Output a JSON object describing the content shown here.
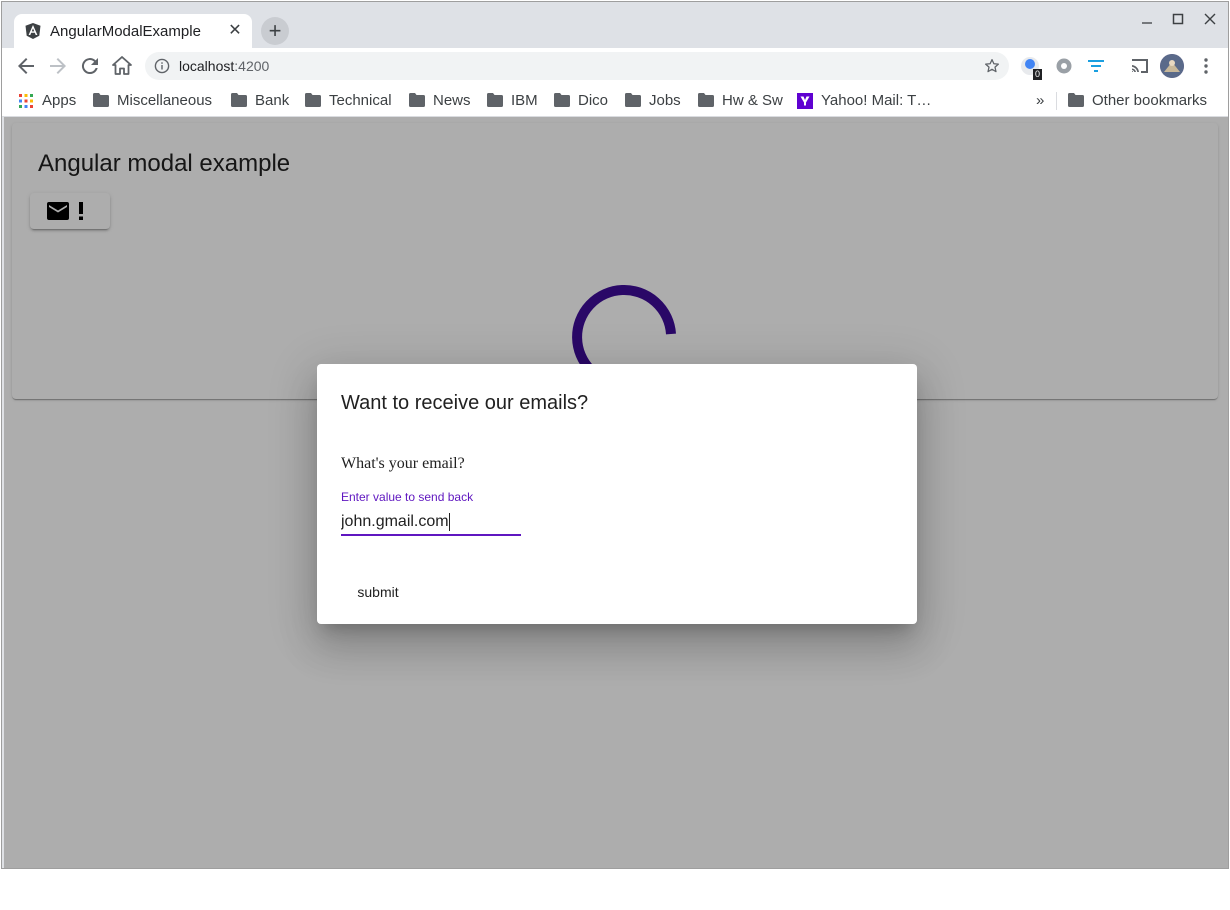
{
  "browser": {
    "tab_title": "AngularModalExample",
    "url_host": "localhost",
    "url_port": ":4200",
    "extension_badge": "0",
    "bookmarks": [
      {
        "label": "Apps",
        "icon": "apps-grid-icon"
      },
      {
        "label": "Miscellaneous",
        "icon": "folder-icon"
      },
      {
        "label": "Bank",
        "icon": "folder-icon"
      },
      {
        "label": "Technical",
        "icon": "folder-icon"
      },
      {
        "label": "News",
        "icon": "folder-icon"
      },
      {
        "label": "IBM",
        "icon": "folder-icon"
      },
      {
        "label": "Dico",
        "icon": "folder-icon"
      },
      {
        "label": "Jobs",
        "icon": "folder-icon"
      },
      {
        "label": "Hw & Sw",
        "icon": "folder-icon"
      },
      {
        "label": "Yahoo! Mail: T…",
        "icon": "yahoo-icon"
      }
    ],
    "overflow": "»",
    "other_bookmarks": "Other bookmarks"
  },
  "page": {
    "title": "Angular modal example",
    "toolbar_icons": [
      "mail-icon",
      "exclamation-icon"
    ],
    "spinner_color": "#3f0c99"
  },
  "dialog": {
    "title": "Want to receive our emails?",
    "question": "What's your email?",
    "field_label": "Enter value to send back",
    "field_value": "john.gmail.com",
    "submit_label": "submit",
    "accent_color": "#5f16c0"
  }
}
